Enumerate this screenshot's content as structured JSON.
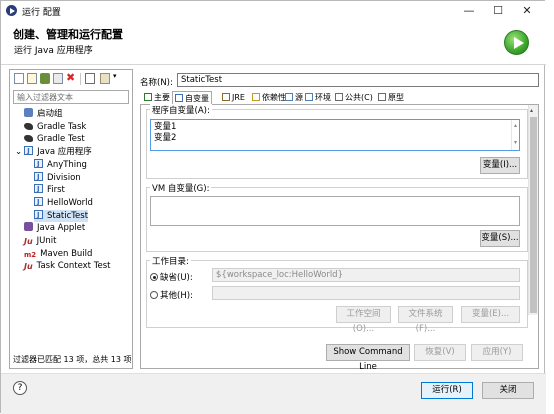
{
  "window": {
    "title": "运行 配置",
    "minimize": "—",
    "maximize": "☐",
    "close": "✕"
  },
  "header": {
    "title": "创建、管理和运行配置",
    "subtitle": "运行 Java 应用程序"
  },
  "left_panel": {
    "filter_placeholder": "输入过滤器文本",
    "tree": [
      {
        "label": "启动组",
        "icon": "launch-group-icon",
        "indent": 1
      },
      {
        "label": "Gradle Task",
        "icon": "gradle-icon",
        "indent": 1
      },
      {
        "label": "Gradle Test",
        "icon": "gradle-icon",
        "indent": 1
      },
      {
        "label": "Java 应用程序",
        "icon": "java-app-icon",
        "indent": 0,
        "expanded": true
      },
      {
        "label": "AnyThing",
        "icon": "java-app-icon",
        "indent": 2
      },
      {
        "label": "Division",
        "icon": "java-app-icon",
        "indent": 2
      },
      {
        "label": "First",
        "icon": "java-app-icon",
        "indent": 2
      },
      {
        "label": "HelloWorld",
        "icon": "java-app-icon",
        "indent": 2
      },
      {
        "label": "StaticTest",
        "icon": "java-app-icon",
        "indent": 2,
        "selected": true
      },
      {
        "label": "Java Applet",
        "icon": "applet-icon",
        "indent": 1
      },
      {
        "label": "JUnit",
        "icon": "junit-icon",
        "indent": 1
      },
      {
        "label": "Maven Build",
        "icon": "maven-icon",
        "indent": 1
      },
      {
        "label": "Task Context Test",
        "icon": "junit-icon",
        "indent": 1
      }
    ],
    "status": "过滤器已匹配 13 项，总共 13 项"
  },
  "config": {
    "name_label": "名称(N):",
    "name_value": "StaticTest",
    "tabs": [
      {
        "label": "主要",
        "icon": "main-tab-icon",
        "active": false
      },
      {
        "label": "自变量",
        "icon": "arguments-tab-icon",
        "active": true
      },
      {
        "label": "JRE",
        "icon": "jre-tab-icon",
        "active": false
      },
      {
        "label": "依赖性",
        "icon": "dependencies-tab-icon",
        "active": false
      },
      {
        "label": "源",
        "icon": "source-tab-icon",
        "active": false
      },
      {
        "label": "环境",
        "icon": "environment-tab-icon",
        "active": false
      },
      {
        "label": "公共(C)",
        "icon": "common-tab-icon",
        "active": false
      },
      {
        "label": "原型",
        "icon": "prototype-tab-icon",
        "active": false
      }
    ],
    "program_args_label": "程序自变量(A):",
    "program_args_lines": [
      "变量1",
      "变量2"
    ],
    "program_vars_button": "变量(I)...",
    "vm_args_label": "VM 自变量(G):",
    "vm_args_value": "",
    "vm_vars_button": "变量(S)...",
    "workdir_label": "工作目录:",
    "workdir_default_label": "缺省(U):",
    "workdir_default_value": "${workspace_loc:HelloWorld}",
    "workdir_other_label": "其他(H):",
    "workdir_other_value": "",
    "workspace_button": "工作空间(O)...",
    "filesystem_button": "文件系统(F)...",
    "variables_button": "变量(E)..."
  },
  "actions": {
    "show_command_line": "Show Command Line",
    "revert": "恢复(V)",
    "apply": "应用(Y)",
    "run": "运行(R)",
    "close": "关闭",
    "help": "?"
  }
}
